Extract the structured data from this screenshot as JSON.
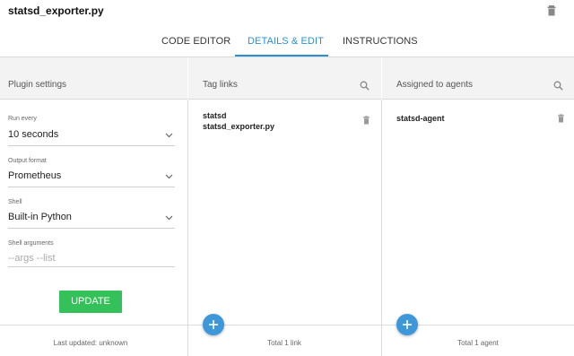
{
  "header": {
    "title": "statsd_exporter.py",
    "trash_icon": "trash-icon"
  },
  "tabs": [
    {
      "label": "CODE EDITOR",
      "active": false
    },
    {
      "label": "DETAILS & EDIT",
      "active": true
    },
    {
      "label": "INSTRUCTIONS",
      "active": false
    }
  ],
  "columns": {
    "plugin": {
      "heading": "Plugin settings"
    },
    "tags": {
      "heading": "Tag links"
    },
    "agents": {
      "heading": "Assigned to agents"
    }
  },
  "plugin_settings": {
    "run_every": {
      "label": "Run every",
      "value": "10 seconds"
    },
    "output_format": {
      "label": "Output format",
      "value": "Prometheus"
    },
    "shell": {
      "label": "Shell",
      "value": "Built-in Python"
    },
    "shell_arguments": {
      "label": "Shell arguments",
      "placeholder": "--args --list"
    },
    "update_label": "UPDATE"
  },
  "tag_links": [
    {
      "name": "statsd",
      "file": "statsd_exporter.py"
    }
  ],
  "agents": [
    {
      "name": "statsd-agent"
    }
  ],
  "footer": {
    "plugin": "Last updated: unknown",
    "tags": "Total 1 link",
    "agents": "Total 1 agent"
  },
  "colors": {
    "accent": "#2b8fd4",
    "update_button": "#35c15a",
    "fab": "#3d97d9"
  }
}
